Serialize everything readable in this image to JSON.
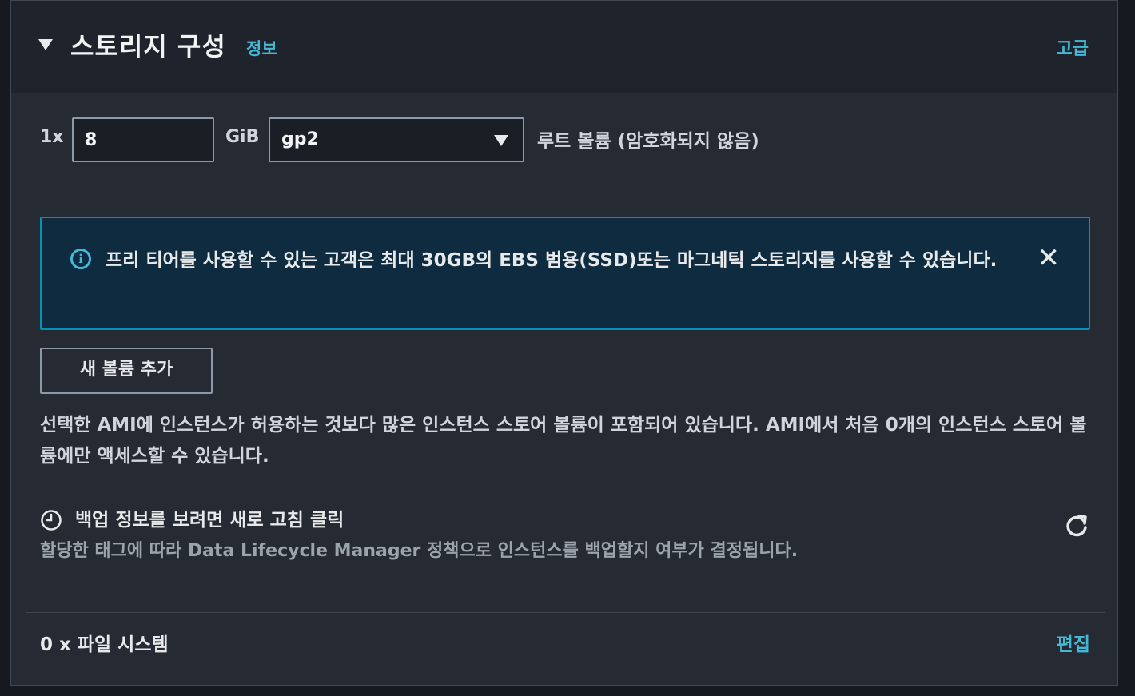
{
  "section": {
    "title": "스토리지 구성",
    "info_link": "정보",
    "advanced_link": "고급"
  },
  "root_volume": {
    "count_label": "1x",
    "size_value": "8",
    "unit_label": "GiB",
    "volume_type": "gp2",
    "description": "루트 볼륨  (암호화되지 않음)"
  },
  "alert": {
    "message": "프리 티어를 사용할 수 있는 고객은 최대 30GB의 EBS 범용(SSD)또는 마그네틱 스토리지를 사용할 수 있습니다.",
    "close_glyph": "✕",
    "info_glyph": "i"
  },
  "add_volume_button": "새 볼륨 추가",
  "ami_note": "선택한 AMI에 인스턴스가 허용하는 것보다 많은 인스턴스 스토어 볼륨이 포함되어 있습니다. AMI에서 처음 0개의 인스턴스 스토어 볼륨에만 액세스할 수 있습니다.",
  "backup": {
    "title": "백업 정보를 보려면 새로 고침 클릭",
    "description": "할당한 태그에 따라 Data Lifecycle Manager 정책으로 인스턴스를 백업할지 여부가 결정됩니다."
  },
  "file_systems": {
    "label": "0 x 파일 시스템",
    "edit_link": "편집"
  },
  "colors": {
    "background": "#252a33",
    "header": "#1f242c",
    "link": "#44b9d6",
    "alert_bg": "#0e2b3f",
    "alert_border": "#0a8fb8"
  }
}
